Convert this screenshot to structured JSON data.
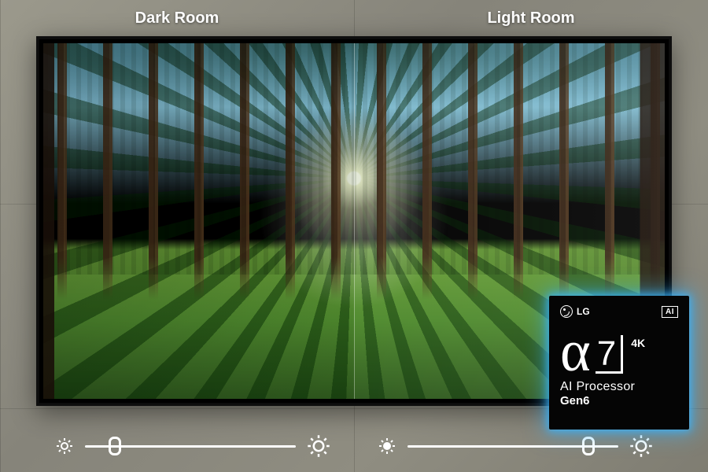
{
  "labels": {
    "dark": "Dark Room",
    "light": "Light Room"
  },
  "sliders": {
    "dark": {
      "position_pct": 14
    },
    "light": {
      "position_pct": 86
    }
  },
  "chip": {
    "brand": "LG",
    "ai_badge": "AI",
    "alpha_glyph": "α",
    "model_number": "7",
    "resolution": "4K",
    "line1": "AI Processor",
    "line2": "Gen6"
  }
}
